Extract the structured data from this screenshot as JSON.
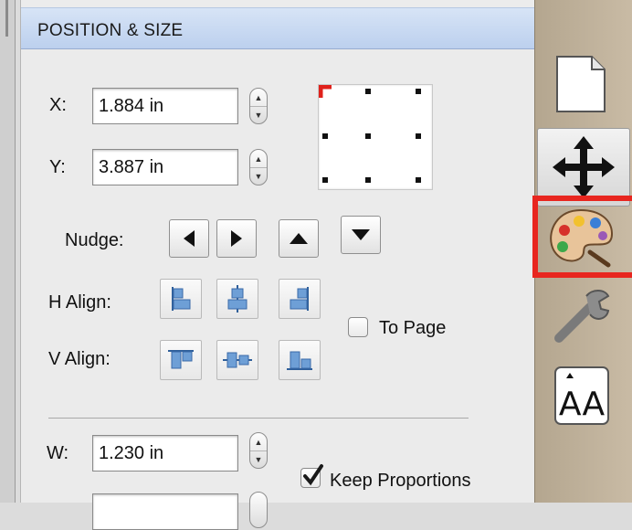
{
  "panel": {
    "title": "POSITION & SIZE"
  },
  "position": {
    "x_label": "X:",
    "x_value": "1.884 in",
    "y_label": "Y:",
    "y_value": "3.887 in"
  },
  "nudge": {
    "label": "Nudge:",
    "buttons": [
      "left",
      "right",
      "up",
      "down"
    ]
  },
  "align": {
    "h_label": "H Align:",
    "v_label": "V Align:",
    "to_page_label": "To Page",
    "to_page_checked": false
  },
  "size": {
    "w_label": "W:",
    "w_value": "1.230 in",
    "keep_proportions_label": "Keep Proportions",
    "keep_proportions_checked": true
  },
  "toolbar": {
    "items": [
      "document-icon",
      "move-icon",
      "palette-icon",
      "wrench-icon",
      "text-size-icon"
    ],
    "text_size_glyph": "AA"
  },
  "colors": {
    "header_blue": "#c4d6f0",
    "highlight_red": "#e8261f",
    "toolbar_tan": "#c2b49d",
    "align_blue": "#6e9fd6"
  }
}
